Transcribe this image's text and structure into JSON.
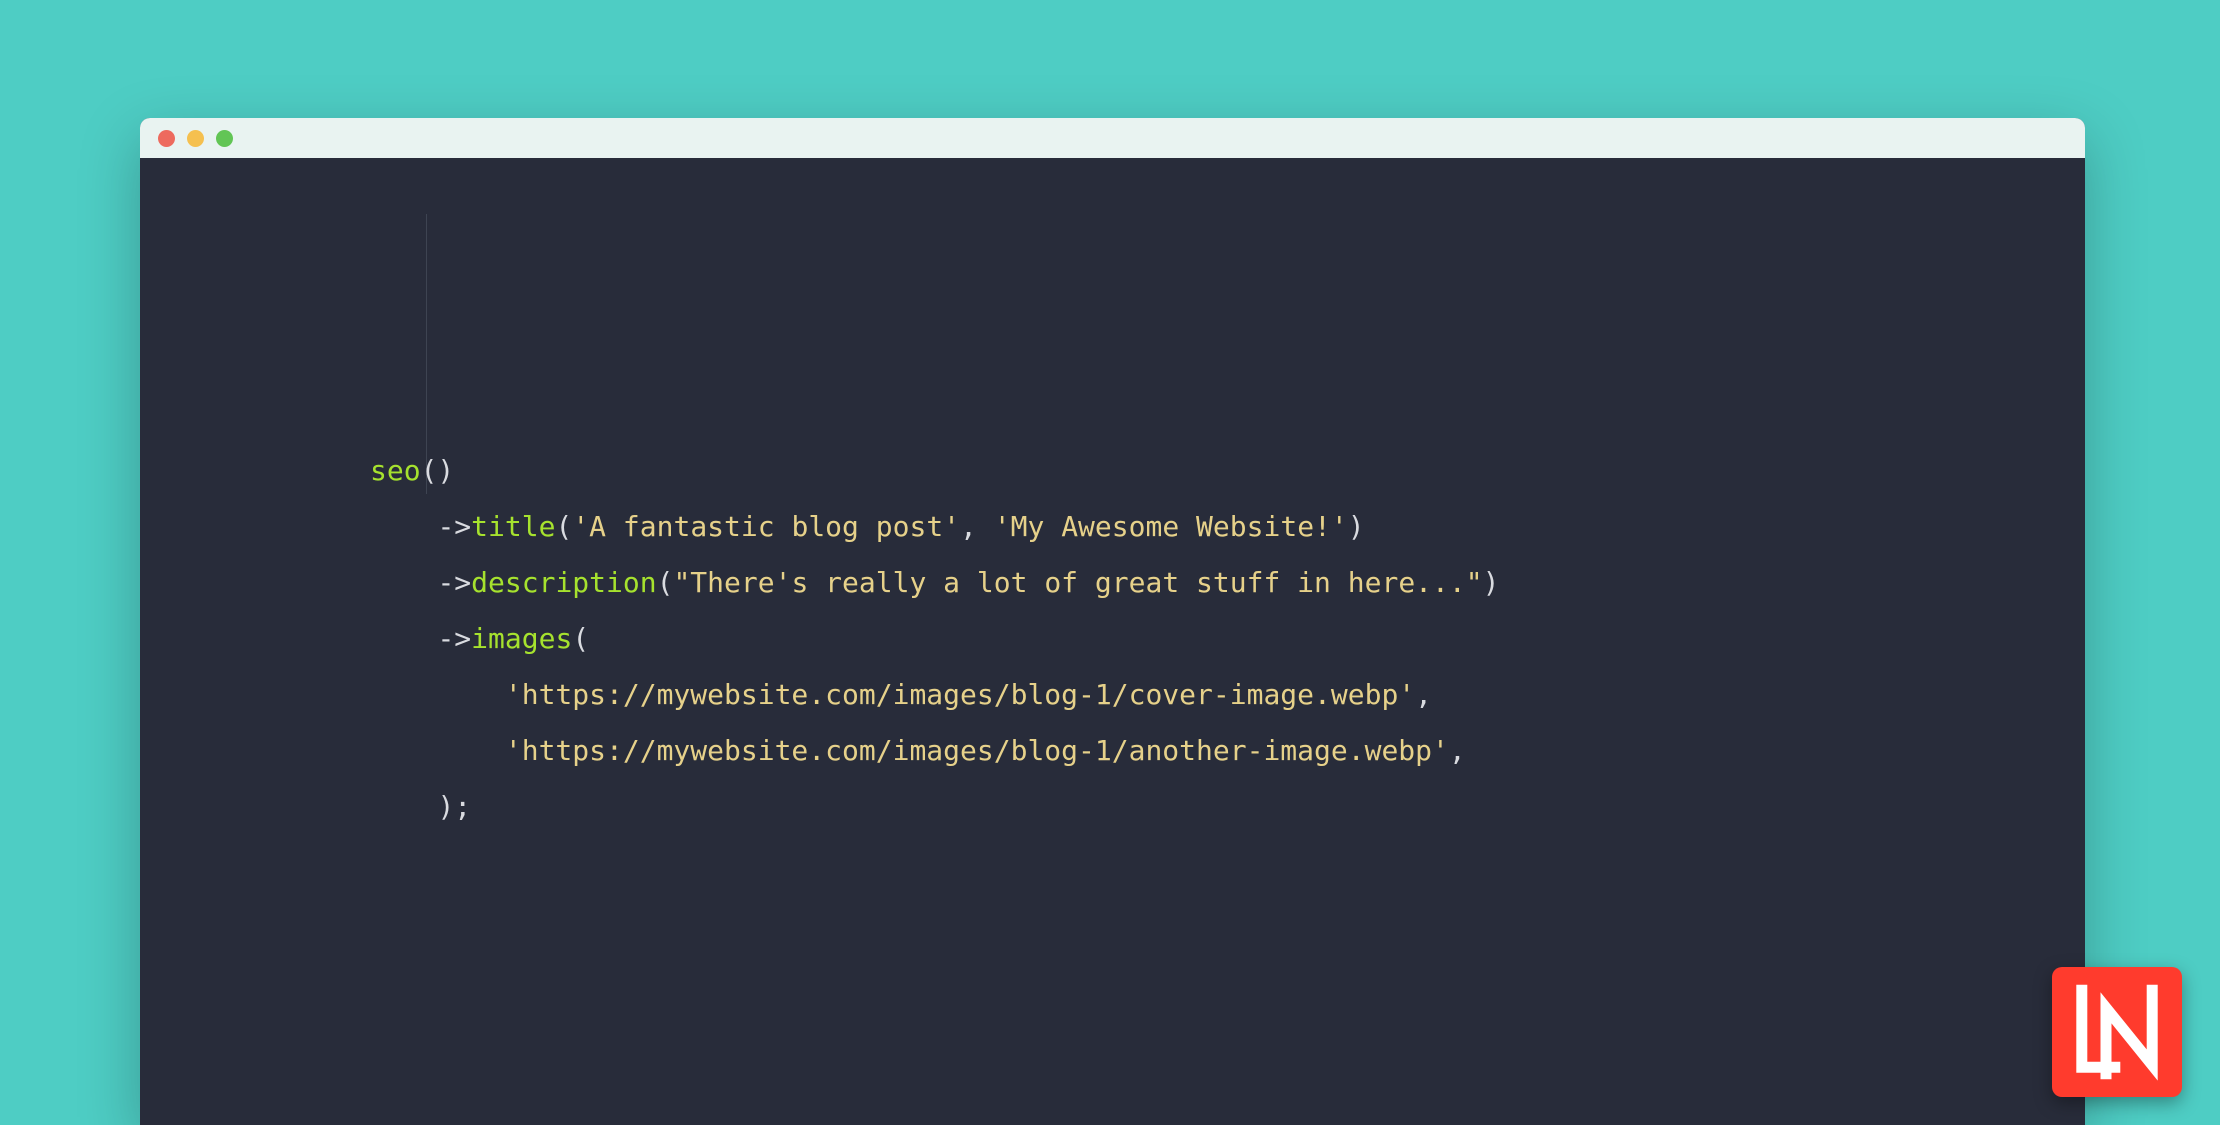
{
  "window": {
    "traffic_lights": {
      "close": "close",
      "minimize": "minimize",
      "maximize": "maximize"
    }
  },
  "code": {
    "l1": {
      "fn": "seo",
      "open": "()"
    },
    "l2": {
      "arrow": "->",
      "fn": "title",
      "open": "(",
      "s1": "'A fantastic blog post'",
      "comma": ", ",
      "s2": "'My Awesome Website!'",
      "close": ")"
    },
    "l3": {
      "arrow": "->",
      "fn": "description",
      "open": "(",
      "s1": "\"There's really a lot of great stuff in here...\"",
      "close": ")"
    },
    "l4": {
      "arrow": "->",
      "fn": "images",
      "open": "("
    },
    "l5": {
      "s1": "'https://mywebsite.com/images/blog-1/cover-image.webp'",
      "comma": ","
    },
    "l6": {
      "s1": "'https://mywebsite.com/images/blog-1/another-image.webp'",
      "comma": ","
    },
    "l7": {
      "close": ");"
    }
  },
  "logo": {
    "text": "LN"
  }
}
